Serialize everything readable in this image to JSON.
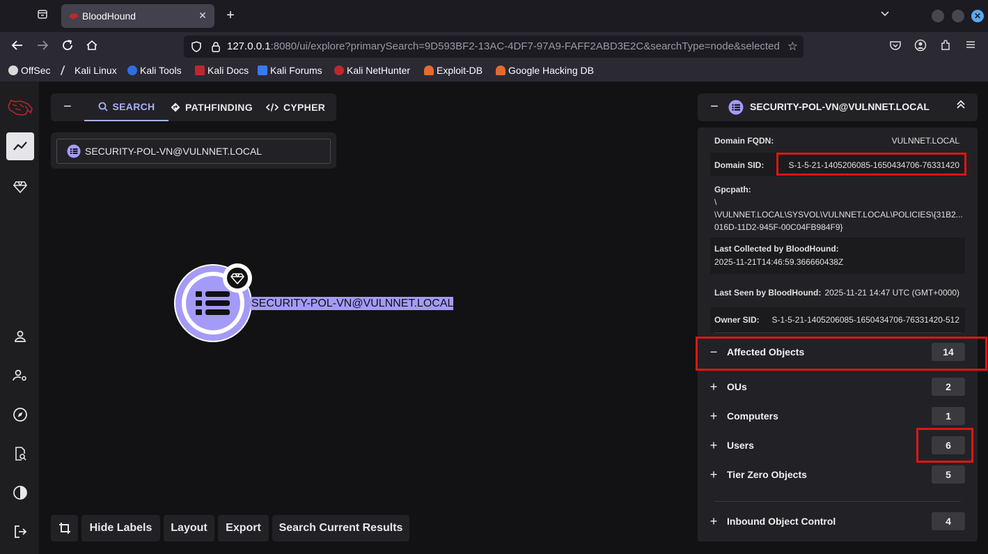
{
  "browser": {
    "tab_title": "BloodHound",
    "url_host": "127.0.0.1",
    "url_rest": ":8080/ui/explore?primarySearch=9D593BF2-13AC-4DF7-97A9-FAFF2ABD3E2C&searchType=node&selected",
    "bookmarks": [
      {
        "label": "OffSec",
        "color": "#d9d9d9"
      },
      {
        "label": "Kali Linux",
        "color": "#367bf0"
      },
      {
        "label": "Kali Tools",
        "color": "#2e6fe0"
      },
      {
        "label": "Kali Docs",
        "color": "#c0272d"
      },
      {
        "label": "Kali Forums",
        "color": "#367bf0"
      },
      {
        "label": "Kali NetHunter",
        "color": "#c0272d"
      },
      {
        "label": "Exploit-DB",
        "color": "#e66a2c"
      },
      {
        "label": "Google Hacking DB",
        "color": "#e66a2c"
      }
    ]
  },
  "explore": {
    "tabs": {
      "search": "SEARCH",
      "pathfinding": "PATHFINDING",
      "cypher": "CYPHER"
    },
    "search_value": "SECURITY-POL-VN@VULNNET.LOCAL",
    "node_label": "SECURITY-POL-VN@VULNNET.LOCAL",
    "bottom": {
      "hide_labels": "Hide Labels",
      "layout": "Layout",
      "export": "Export",
      "search_current": "Search Current Results"
    }
  },
  "panel": {
    "title": "SECURITY-POL-VN@VULNNET.LOCAL",
    "props": {
      "domain_fqdn_key": "Domain FQDN:",
      "domain_fqdn_val": "VULNNET.LOCAL",
      "domain_sid_key": "Domain SID:",
      "domain_sid_val": "S-1-5-21-1405206085-1650434706-76331420",
      "gpcpath_key": "Gpcpath:",
      "gpcpath_line1": "\\",
      "gpcpath_line2": "\\VULNNET.LOCAL\\SYSVOL\\VULNNET.LOCAL\\POLICIES\\{31B2...",
      "gpcpath_line3": "016D-11D2-945F-00C04FB984F9}",
      "last_collected_key": "Last Collected by BloodHound:",
      "last_collected_val": "2025-11-21T14:46:59.366660438Z",
      "last_seen_key": "Last Seen by BloodHound:",
      "last_seen_val": "2025-11-21 14:47 UTC (GMT+0000)",
      "owner_sid_key": "Owner SID:",
      "owner_sid_val": "S-1-5-21-1405206085-1650434706-76331420-512"
    },
    "sections": {
      "affected": {
        "label": "Affected Objects",
        "count": "14",
        "sign": "−"
      },
      "ous": {
        "label": "OUs",
        "count": "2",
        "sign": "+"
      },
      "computers": {
        "label": "Computers",
        "count": "1",
        "sign": "+"
      },
      "users": {
        "label": "Users",
        "count": "6",
        "sign": "+"
      },
      "tier_zero": {
        "label": "Tier Zero Objects",
        "count": "5",
        "sign": "+"
      },
      "inbound": {
        "label": "Inbound Object Control",
        "count": "4",
        "sign": "+"
      }
    }
  },
  "colors": {
    "node": "#a49bf8",
    "accent": "#a9b2f8",
    "highlight": "#e01414"
  }
}
